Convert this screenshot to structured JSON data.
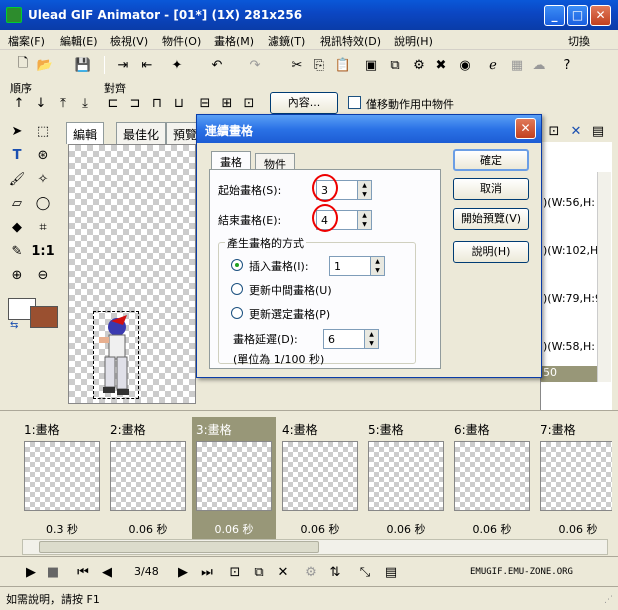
{
  "window": {
    "title": "Ulead GIF Animator - [01*] (1X) 281x256",
    "minimize": "_",
    "maximize": "□",
    "close": "✕"
  },
  "menus": [
    "檔案(F)",
    "編輯(E)",
    "檢視(V)",
    "物件(O)",
    "畫格(M)",
    "濾鏡(T)",
    "視訊特效(D)",
    "說明(H)"
  ],
  "menu_right": "切換",
  "toolbar2": {
    "order_label": "順序",
    "align_label": "對齊",
    "content_button": "內容...",
    "move_only_checkbox": "僅移動作用中物件"
  },
  "canvas_tabs": [
    "編輯",
    "最佳化",
    "預覽"
  ],
  "right_panel": {
    "items": [
      ")(W:56,H:",
      ")(W:102,H:",
      ")(W:79,H:9",
      ")(W:58,H:"
    ],
    "footer": "50"
  },
  "dialog": {
    "title": "連續畫格",
    "tabs": [
      "畫格",
      "物件"
    ],
    "start_frame_label": "起始畫格(S):",
    "start_frame_value": "3",
    "end_frame_label": "結束畫格(E):",
    "end_frame_value": "4",
    "group_label": "產生畫格的方式",
    "insert_label": "插入畫格(I):",
    "insert_value": "1",
    "update_middle_label": "更新中間畫格(U)",
    "update_selected_label": "更新選定畫格(P)",
    "delay_label": "畫格延遲(D):",
    "delay_value": "6",
    "unit_note": "(單位為 1/100 秒)",
    "buttons": {
      "ok": "確定",
      "cancel": "取消",
      "preview": "開始預覽(V)",
      "help": "說明(H)"
    }
  },
  "frames": [
    {
      "label": "1:畫格",
      "delay": "0.3 秒",
      "selected": false
    },
    {
      "label": "2:畫格",
      "delay": "0.06 秒",
      "selected": false
    },
    {
      "label": "3:畫格",
      "delay": "0.06 秒",
      "selected": true
    },
    {
      "label": "4:畫格",
      "delay": "0.06 秒",
      "selected": false
    },
    {
      "label": "5:畫格",
      "delay": "0.06 秒",
      "selected": false
    },
    {
      "label": "6:畫格",
      "delay": "0.06 秒",
      "selected": false
    },
    {
      "label": "7:畫格",
      "delay": "0.06 秒",
      "selected": false
    }
  ],
  "playbar": {
    "frame_counter": "3/48",
    "watermark": "EMUGIF.EMU-ZONE.ORG"
  },
  "status": {
    "help_text": "如需說明，請按 F1"
  },
  "colors": {
    "titlebar": "#0b46c2",
    "background_swatch": "#9a5030",
    "selected_frame": "#989778",
    "highlight_ring": "#e00000"
  }
}
